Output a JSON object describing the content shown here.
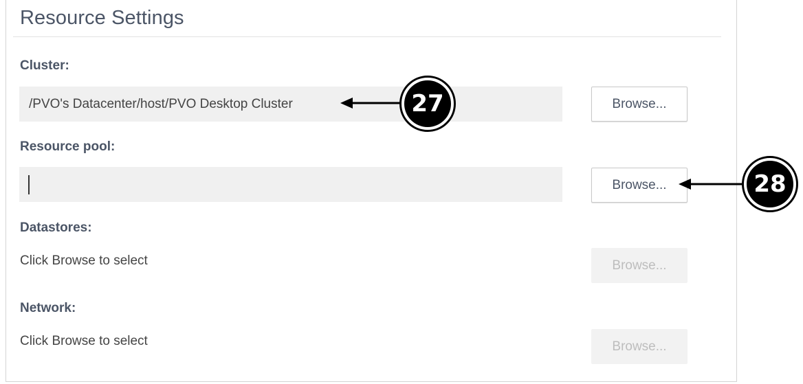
{
  "section": {
    "title": "Resource Settings"
  },
  "cluster": {
    "label": "Cluster:",
    "value": "/PVO's Datacenter/host/PVO Desktop Cluster",
    "browse_label": "Browse..."
  },
  "resource_pool": {
    "label": "Resource pool:",
    "value": "",
    "browse_label": "Browse..."
  },
  "datastores": {
    "label": "Datastores:",
    "value": "Click Browse to select",
    "browse_label": "Browse...",
    "browse_disabled": true
  },
  "network": {
    "label": "Network:",
    "value": "Click Browse to select",
    "browse_label": "Browse...",
    "browse_disabled": true
  },
  "callouts": [
    {
      "number": "27"
    },
    {
      "number": "28"
    }
  ],
  "colors": {
    "label_text": "#4b5566",
    "field_bg": "#f0f0f0",
    "disabled_text": "#bdbdbd",
    "callout": "#000000"
  }
}
